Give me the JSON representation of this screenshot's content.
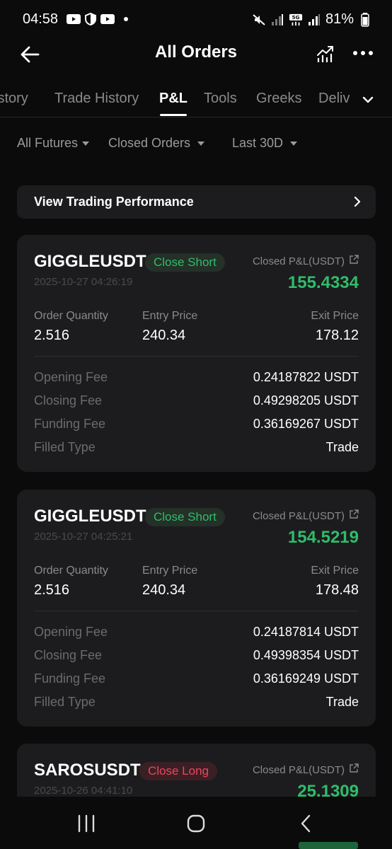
{
  "status_bar": {
    "time": "04:58",
    "battery": "81%"
  },
  "header": {
    "title": "All Orders"
  },
  "tabs": [
    {
      "label": "istory"
    },
    {
      "label": "Trade History"
    },
    {
      "label": "P&L"
    },
    {
      "label": "Tools"
    },
    {
      "label": "Greeks"
    },
    {
      "label": "Deliv"
    }
  ],
  "filters": {
    "product": "All Futures",
    "order_type": "Closed Orders",
    "period": "Last 30D"
  },
  "performance": {
    "label": "View Trading Performance"
  },
  "labels": {
    "closed_pnl": "Closed P&L(USDT)",
    "order_quantity": "Order Quantity",
    "entry_price": "Entry Price",
    "exit_price": "Exit Price",
    "opening_fee": "Opening Fee",
    "closing_fee": "Closing Fee",
    "funding_fee": "Funding Fee",
    "filled_type": "Filled Type"
  },
  "orders": [
    {
      "symbol": "GIGGLEUSDT",
      "side": "Close Short",
      "side_color": "#2fbd6a",
      "time": "2025-10-27 04:26:19",
      "pnl": "155.4334",
      "quantity": "2.516",
      "entry_price": "240.34",
      "exit_price": "178.12",
      "opening_fee": "0.24187822 USDT",
      "closing_fee": "0.49298205 USDT",
      "funding_fee": "0.36169267 USDT",
      "filled_type": "Trade"
    },
    {
      "symbol": "GIGGLEUSDT",
      "side": "Close Short",
      "side_color": "#2fbd6a",
      "time": "2025-10-27 04:25:21",
      "pnl": "154.5219",
      "quantity": "2.516",
      "entry_price": "240.34",
      "exit_price": "178.48",
      "opening_fee": "0.24187814 USDT",
      "closing_fee": "0.49398354 USDT",
      "funding_fee": "0.36169249 USDT",
      "filled_type": "Trade"
    },
    {
      "symbol": "SAROSUSDT",
      "side": "Close Long",
      "side_color": "#f0445a",
      "time": "2025-10-26 04:41:10",
      "pnl": "25.1309"
    }
  ],
  "colors": {
    "profit": "#2fbd6a",
    "loss": "#f0445a",
    "card_bg": "#1c1c1e"
  },
  "icons": {
    "status": [
      "youtube-icon",
      "shield-icon",
      "youtube-icon",
      "mute-icon",
      "signal-icon",
      "5g-icon",
      "battery-icon"
    ],
    "header": [
      "back-arrow-icon",
      "chart-icon",
      "more-icon"
    ],
    "nav": [
      "recent-apps-icon",
      "home-icon",
      "back-icon"
    ]
  }
}
